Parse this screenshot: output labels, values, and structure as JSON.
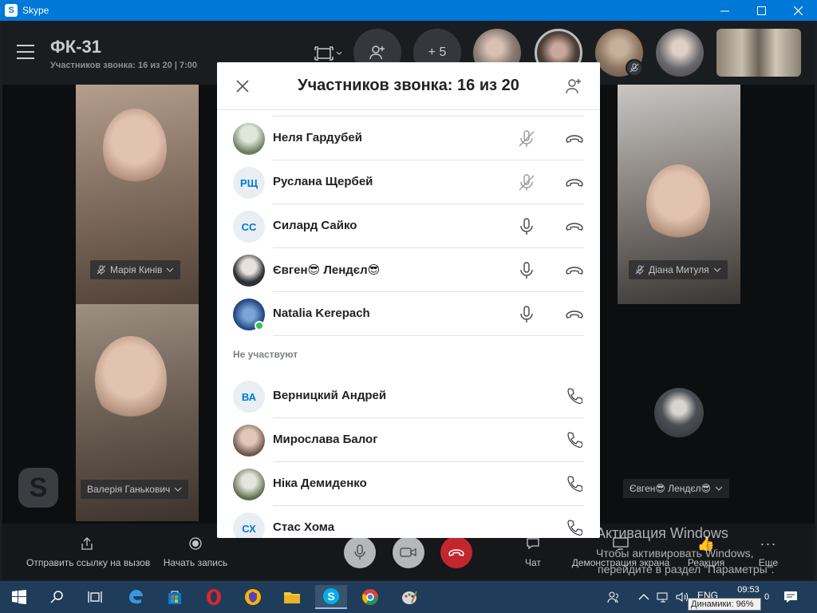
{
  "window": {
    "title": "Skype",
    "app_icon": "S"
  },
  "call": {
    "title": "ФК-31",
    "subtitle": "Участников звонка: 16 из 20 | 7:00",
    "plus_more": "+ 5"
  },
  "tiles": [
    {
      "name": "Марія Кинів"
    },
    {
      "name": "Валерія Ганькович"
    },
    {
      "name": "Діана Митуля"
    },
    {
      "name": "Євген😎 Лендєл😎"
    }
  ],
  "modal": {
    "title": "Участников звонка: 16 из 20",
    "participants": [
      {
        "name": "Неля Гардубей",
        "initials": "",
        "avatar": "photo1",
        "mic": "muted"
      },
      {
        "name": "Руслана Щербей",
        "initials": "РЩ",
        "avatar": "initials",
        "mic": "muted"
      },
      {
        "name": "Силард Сайко",
        "initials": "СС",
        "avatar": "initials",
        "mic": "on"
      },
      {
        "name": "Євген😎 Лендєл😎",
        "initials": "",
        "avatar": "photo2",
        "mic": "on"
      },
      {
        "name": "Natalia Kerepach",
        "initials": "",
        "avatar": "photo3",
        "mic": "on",
        "online": true
      }
    ],
    "not_participating_title": "Не участвуют",
    "not_participating": [
      {
        "name": "Верницкий Андрей",
        "initials": "ВА",
        "avatar": "initials"
      },
      {
        "name": "Мирослава Балог",
        "initials": "",
        "avatar": "photo4"
      },
      {
        "name": "Ніка Демиденко",
        "initials": "",
        "avatar": "photo5"
      },
      {
        "name": "Стас Хома",
        "initials": "СХ",
        "avatar": "initials"
      }
    ]
  },
  "bottom_bar": {
    "send_link": "Отправить ссылку на вызов",
    "record": "Начать запись",
    "chat": "Чат",
    "share_screen": "Демонстрация экрана",
    "reaction": "Реакция",
    "more": "Еще"
  },
  "activation": {
    "title": "Активация Windows",
    "line1": "Чтобы активировать Windows,",
    "line2": "перейдите в раздел \"Параметры\"."
  },
  "taskbar": {
    "lang": "ENG",
    "time": "09:53",
    "date_tail": "0",
    "tooltip": "Динамики: 96%"
  },
  "colors": {
    "accent": "#0078d7",
    "end_call": "#c4262e",
    "online": "#33c35a"
  }
}
